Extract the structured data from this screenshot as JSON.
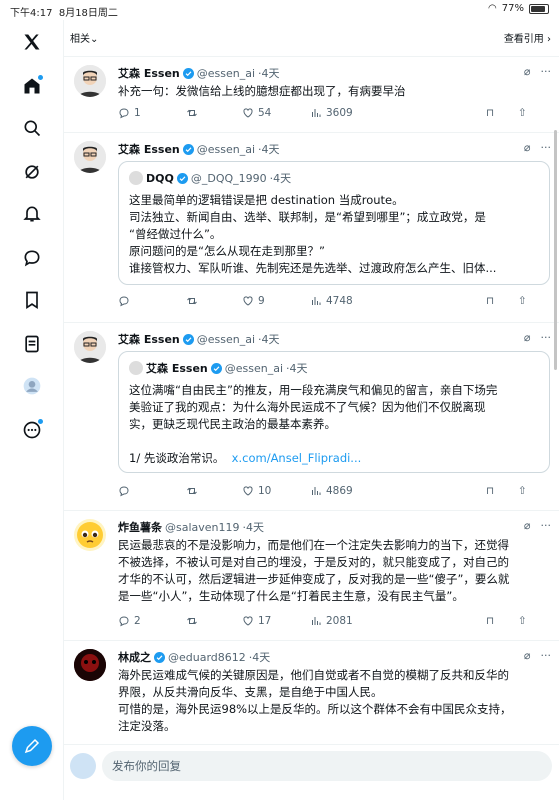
{
  "status_bar": {
    "time": "下午4:17",
    "date": "8月18日周二",
    "battery": "77%"
  },
  "top": {
    "relevant": "相关⌄",
    "view_quotes": "查看引用 ›"
  },
  "tweets": [
    {
      "name": "艾森 Essen",
      "handle": "@essen_ai",
      "time": "·4天",
      "text": "补充一句：发微信给上线的臆想症都出现了，有病要早治",
      "replies": "1",
      "retweets": "",
      "likes": "54",
      "views": "3609"
    },
    {
      "name": "艾森 Essen",
      "handle": "@essen_ai",
      "time": "·4天",
      "quote": {
        "name": "DQQ",
        "handle": "@_DQQ_1990",
        "time": "·4天",
        "lines": [
          "这里最简单的逻辑错误是把 destination 当成route。",
          "司法独立、新闻自由、选举、联邦制，是“希望到哪里”；成立政党，是",
          "“曾经做过什么”。",
          "原问题问的是“怎么从现在走到那里？”",
          "谁接管权力、军队听谁、先制宪还是先选举、过渡政府怎么产生、旧体..."
        ]
      },
      "replies": "",
      "retweets": "",
      "likes": "9",
      "views": "4748"
    },
    {
      "name": "艾森 Essen",
      "handle": "@essen_ai",
      "time": "·4天",
      "quote": {
        "name": "艾森 Essen",
        "handle": "@essen_ai",
        "time": "·4天",
        "lines": [
          "这位满嘴“自由民主”的推友，用一段充满戾气和偏见的留言，亲自下场完",
          "美验证了我的观点：为什么海外民运成不了气候？因为他们不仅脱离现",
          "实，更缺乏现代民主政治的最基本素养。",
          "",
          "1/ 先谈政治常识。"
        ],
        "link": "x.com/Ansel_Flipradi..."
      },
      "replies": "",
      "retweets": "",
      "likes": "10",
      "views": "4869"
    },
    {
      "name": "炸鱼薯条",
      "handle": "@salaven119",
      "time": "·4天",
      "lines": [
        "民运最悲哀的不是没影响力，而是他们在一个注定失去影响力的当下，还觉得",
        "不被选择，不被认可是对自己的埋没，于是反对的，就只能变成了，对自己的",
        "才华的不认可，然后逻辑进一步延伸变成了，反对我的是一些“傻子”，要么就",
        "是一些“小人”，生动体现了什么是“打着民主生意，没有民主气量”。"
      ],
      "replies": "2",
      "retweets": "",
      "likes": "17",
      "views": "2081"
    },
    {
      "name": "林成之",
      "handle": "@eduard8612",
      "time": "·4天",
      "lines": [
        "海外民运难成气候的关键原因是，他们自觉或者不自觉的模糊了反共和反华的",
        "界限，从反共滑向反华、支黑，是自绝于中国人民。",
        "可惜的是，海外民运98%以上是反华的。所以这个群体不会有中国民众支持，",
        "注定没落。"
      ]
    }
  ],
  "reply_bar": {
    "placeholder": "发布你的回复"
  },
  "icons": [
    "x-logo-icon",
    "home-icon",
    "search-icon",
    "grok-icon",
    "bell-icon",
    "messages-icon",
    "bookmark-icon",
    "lists-icon",
    "profile-icon",
    "more-icon",
    "compose-icon"
  ],
  "colors": {
    "accent": "#1d9bf0",
    "text": "#0f1419",
    "muted": "#536471"
  }
}
